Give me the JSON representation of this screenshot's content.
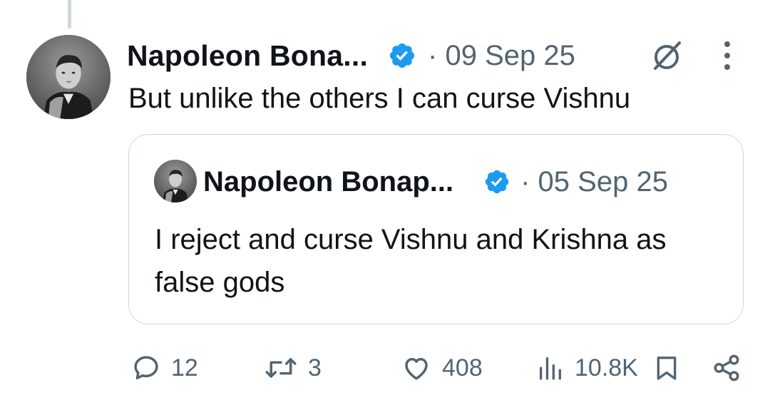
{
  "tweet": {
    "author_name": "Napoleon Bona...",
    "date": "· 09 Sep 25",
    "text": "But unlike the others I can curse Vishnu"
  },
  "quote": {
    "author_name": "Napoleon Bonap...",
    "date": "· 05 Sep 25",
    "text": "I reject and curse Vishnu and Krishna as false gods"
  },
  "actions": {
    "replies": "12",
    "reposts": "3",
    "likes": "408",
    "views": "10.8K"
  },
  "icons": {
    "avatar": "portrait-image",
    "verified": "verified-badge-icon",
    "grok": "grok-icon",
    "more": "more-vertical-icon",
    "reply": "reply-icon",
    "repost": "repost-icon",
    "like": "heart-icon",
    "views": "views-icon",
    "bookmark": "bookmark-icon",
    "share": "share-icon"
  },
  "colors": {
    "verified_blue": "#1d9bf0",
    "secondary_text": "#536471",
    "primary_text": "#0f1419",
    "border": "#cfd9de"
  }
}
